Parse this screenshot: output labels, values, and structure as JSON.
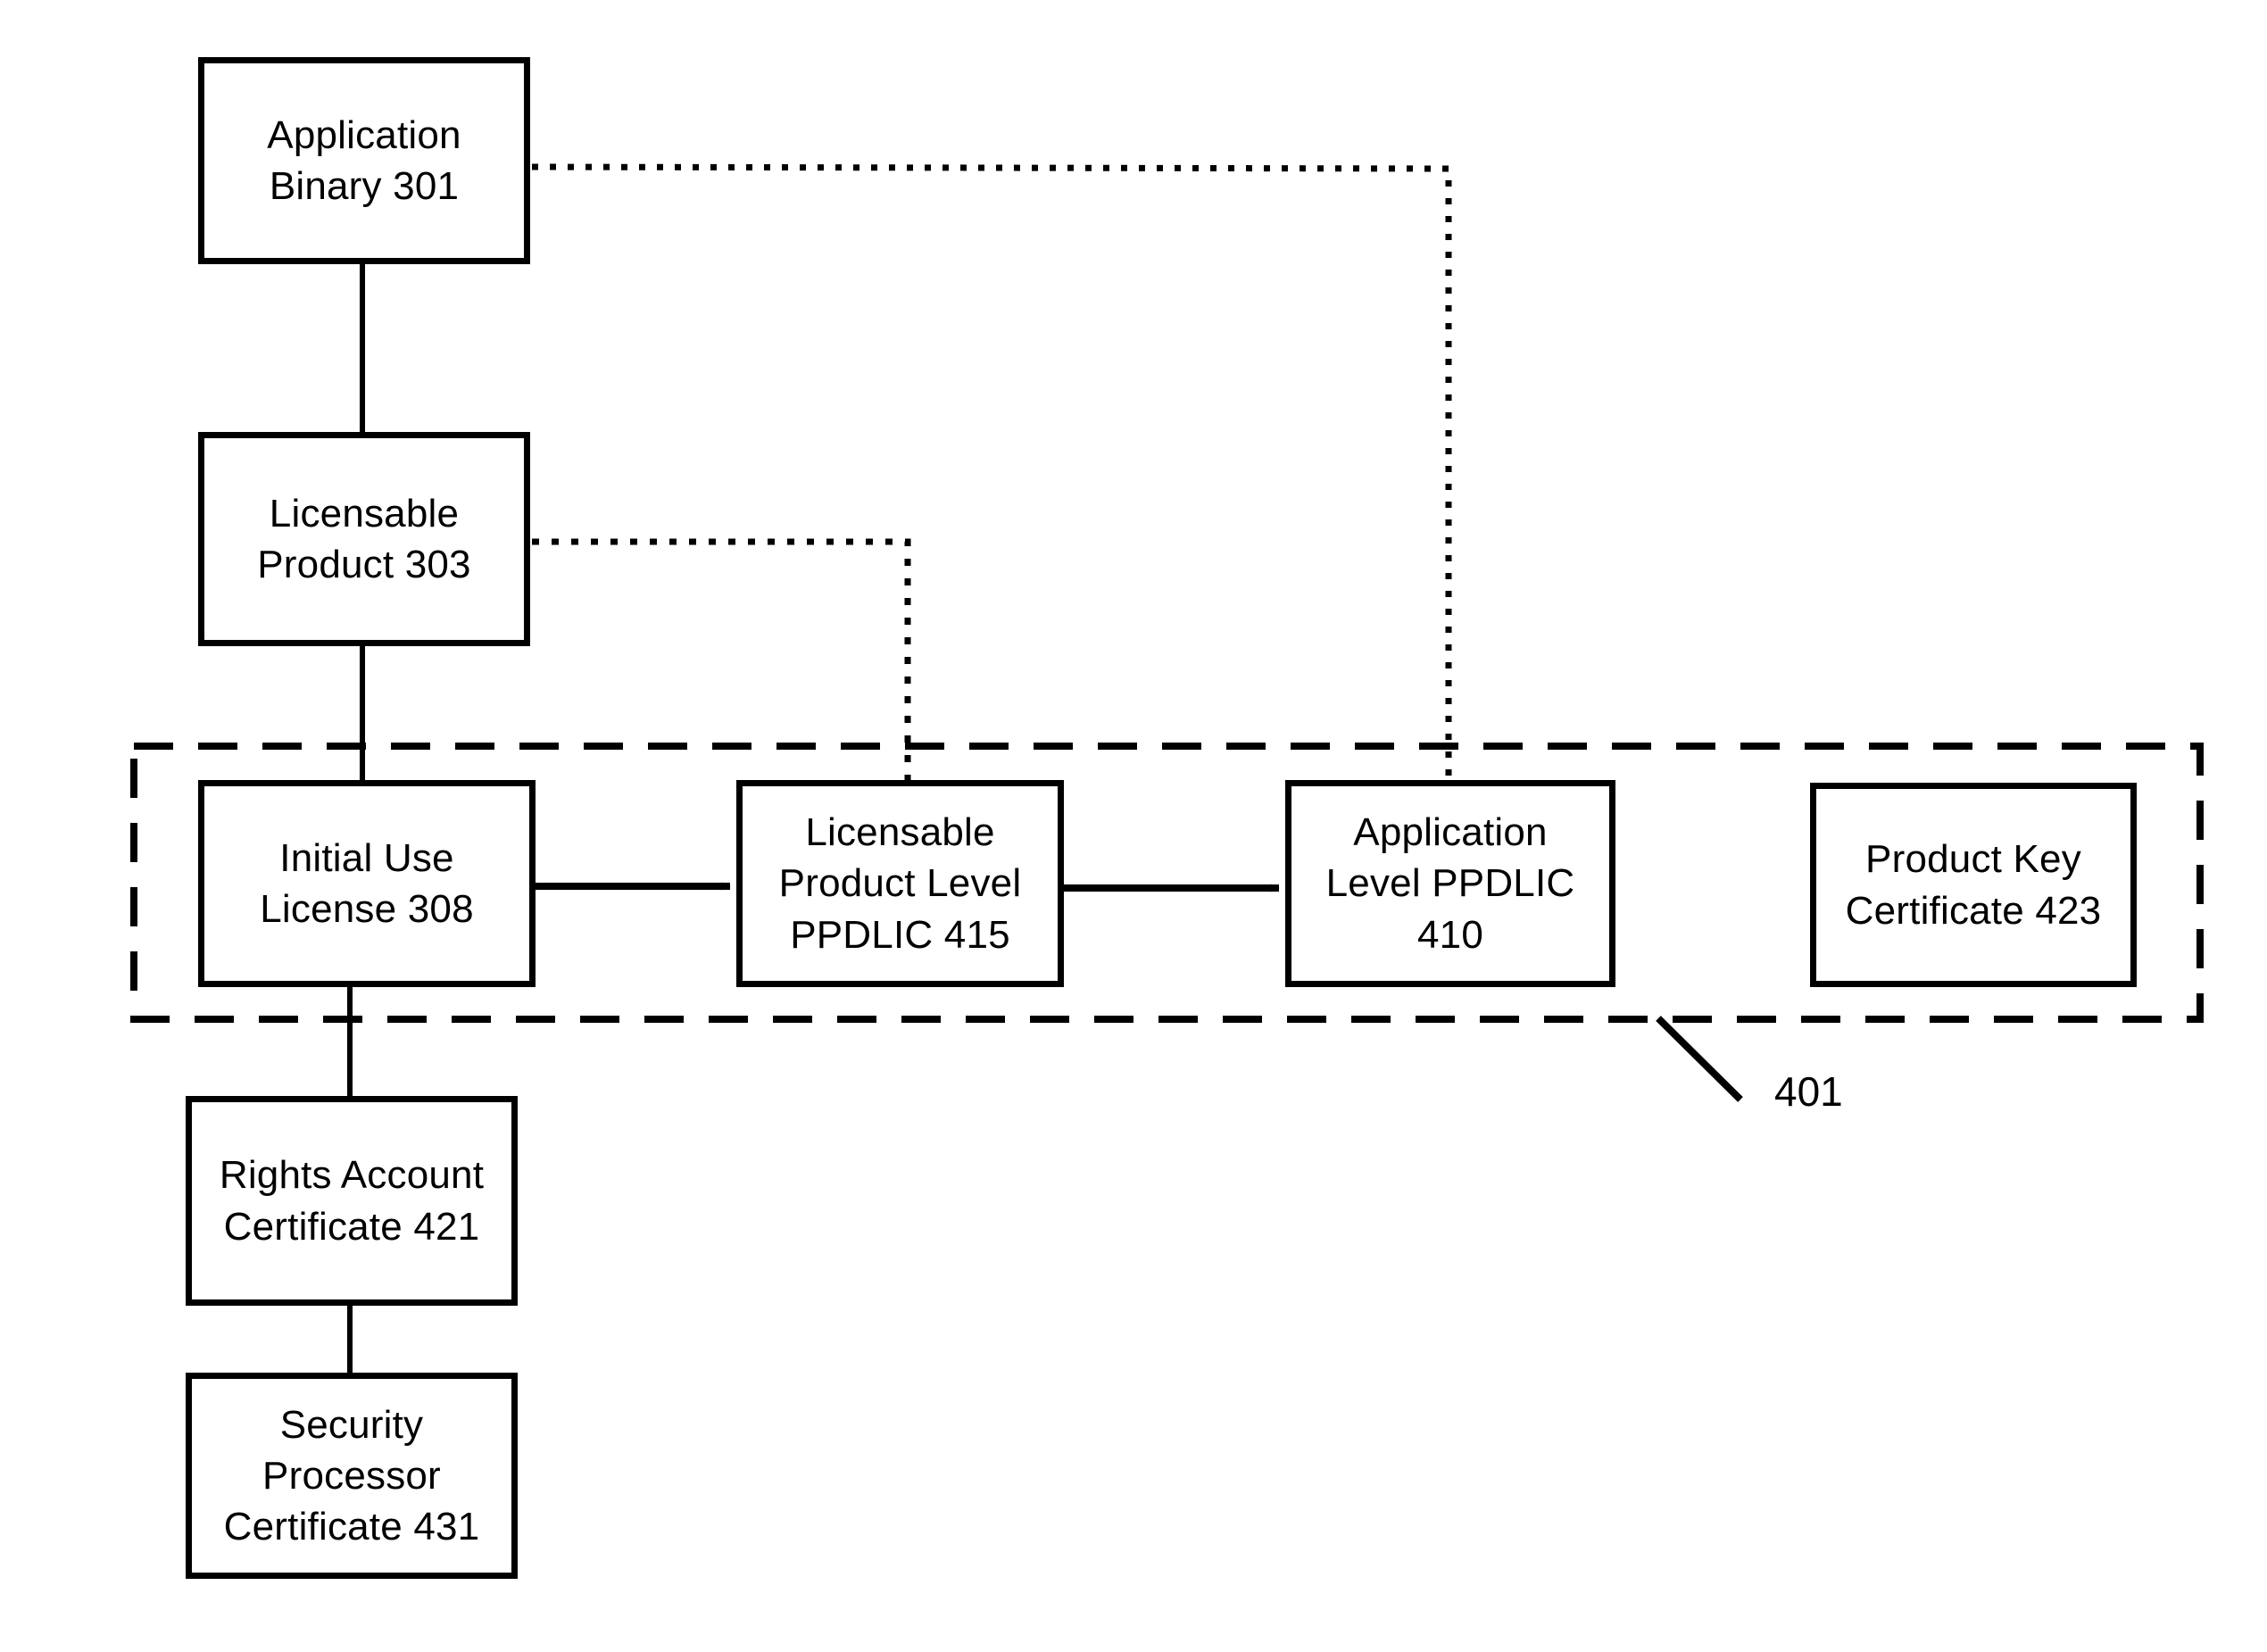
{
  "figure": {
    "type": "block-diagram",
    "style": "patent-line-drawing",
    "background_color": "#ffffff",
    "line_color": "#000000"
  },
  "nodes": [
    {
      "id": "301",
      "name": "application-binary",
      "label": "Application\nBinary 301",
      "ref_number": "301",
      "border": "solid"
    },
    {
      "id": "303",
      "name": "licensable-product",
      "label": "Licensable\nProduct 303",
      "ref_number": "303",
      "border": "solid"
    },
    {
      "id": "308",
      "name": "initial-use-license",
      "label": "Initial Use\nLicense 308",
      "ref_number": "308",
      "border": "solid"
    },
    {
      "id": "415",
      "name": "licensable-product-level-ppdlic",
      "label": "Licensable\nProduct Level\nPPDLIC 415",
      "ref_number": "415",
      "border": "solid"
    },
    {
      "id": "410",
      "name": "application-level-ppdlic",
      "label": "Application\nLevel PPDLIC\n410",
      "ref_number": "410",
      "border": "solid"
    },
    {
      "id": "423",
      "name": "product-key-certificate",
      "label": "Product Key\nCertificate 423",
      "ref_number": "423",
      "border": "solid"
    },
    {
      "id": "421",
      "name": "rights-account-certificate",
      "label": "Rights Account\nCertificate 421",
      "ref_number": "421",
      "border": "solid"
    },
    {
      "id": "431",
      "name": "security-processor-certificate",
      "label": "Security\nProcessor\nCertificate 431",
      "ref_number": "431",
      "border": "solid"
    }
  ],
  "groups": [
    {
      "id": "401",
      "name": "dashed-group-401",
      "ref_number": "401",
      "label": "401",
      "border": "dashed",
      "members": [
        "308",
        "415",
        "410",
        "423"
      ]
    }
  ],
  "connectors": [
    {
      "from": "301",
      "to": "303",
      "style": "solid",
      "arrow": false,
      "name": "connector-301-303"
    },
    {
      "from": "303",
      "to": "308",
      "style": "solid",
      "arrow": false,
      "name": "connector-303-308"
    },
    {
      "from": "308",
      "to": "421",
      "style": "solid",
      "arrow": false,
      "name": "connector-308-421"
    },
    {
      "from": "421",
      "to": "431",
      "style": "solid",
      "arrow": false,
      "name": "connector-421-431"
    },
    {
      "from": "308",
      "to": "415",
      "style": "solid",
      "arrow": true,
      "name": "arrow-308-415"
    },
    {
      "from": "415",
      "to": "410",
      "style": "solid",
      "arrow": true,
      "name": "arrow-415-410"
    },
    {
      "from": "301",
      "to": "410",
      "style": "dotted",
      "arrow": false,
      "name": "dotted-301-410"
    },
    {
      "from": "303",
      "to": "415",
      "style": "dotted",
      "arrow": false,
      "name": "dotted-303-415"
    }
  ]
}
